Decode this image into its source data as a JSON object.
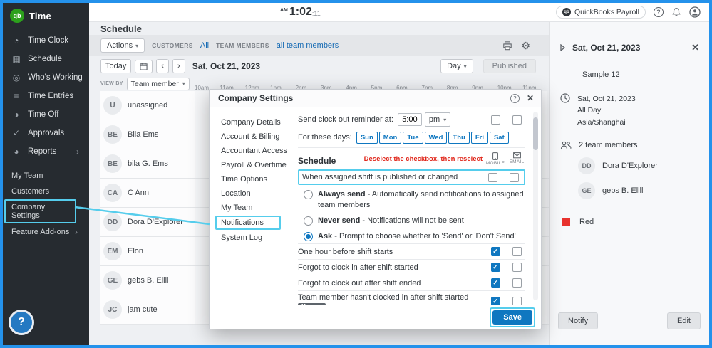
{
  "glyphs": {
    "caret": "▾",
    "chev_left": "‹",
    "chev_right": "›",
    "close": "✕",
    "gear": "⚙",
    "qmark": "?"
  },
  "topbar": {
    "clock_ampm": "AM",
    "clock_time": "1:02",
    "clock_sec": ":11",
    "product_badge": "QuickBooks Payroll",
    "badge_logo": "qb"
  },
  "sidebar": {
    "logo_text": "qb",
    "brand": "Time",
    "items": [
      {
        "label": "Time Clock",
        "glyph": "◔",
        "icon": "time-clock-icon"
      },
      {
        "label": "Schedule",
        "glyph": "▦",
        "icon": "schedule-icon"
      },
      {
        "label": "Who's Working",
        "glyph": "◎",
        "icon": "whos-working-icon"
      },
      {
        "label": "Time Entries",
        "glyph": "≡",
        "icon": "time-entries-icon"
      },
      {
        "label": "Time Off",
        "glyph": "◑",
        "icon": "time-off-icon"
      },
      {
        "label": "Approvals",
        "glyph": "✓",
        "icon": "approvals-icon"
      },
      {
        "label": "Reports",
        "glyph": "◕",
        "icon": "reports-icon",
        "chevron": "›"
      }
    ],
    "links": [
      {
        "label": "My Team"
      },
      {
        "label": "Customers"
      },
      {
        "label": "Company Settings",
        "highlighted": true
      },
      {
        "label": "Feature Add-ons",
        "chevron": "›"
      }
    ],
    "help": "?"
  },
  "schedule": {
    "title": "Schedule",
    "actions_label": "Actions",
    "customers_label": "CUSTOMERS",
    "customers_value": "All",
    "team_label": "TEAM MEMBERS",
    "team_value": "all team members",
    "today_label": "Today",
    "date": "Sat, Oct 21, 2023",
    "view_mode": "Day",
    "published_label": "Published",
    "viewby_label": "VIEW BY",
    "viewby_value": "Team member",
    "time_columns": [
      "10am",
      "11am",
      "12pm",
      "1pm",
      "2pm",
      "3pm",
      "4pm",
      "5pm",
      "6pm",
      "7pm",
      "8pm",
      "9pm",
      "10pm",
      "11pm"
    ],
    "members": [
      {
        "initials": "U",
        "name": "unassigned"
      },
      {
        "initials": "BE",
        "name": "Bila Ems"
      },
      {
        "initials": "BE",
        "name": "bila G. Ems"
      },
      {
        "initials": "CA",
        "name": "C Ann"
      },
      {
        "initials": "DD",
        "name": "Dora D'Explorer"
      },
      {
        "initials": "EM",
        "name": "Elon"
      },
      {
        "initials": "GE",
        "name": "gebs B. Ellll"
      },
      {
        "initials": "JC",
        "name": "jam cute"
      }
    ]
  },
  "modal": {
    "title": "Company Settings",
    "nav": [
      {
        "label": "Company Details"
      },
      {
        "label": "Account & Billing"
      },
      {
        "label": "Accountant Access"
      },
      {
        "label": "Payroll & Overtime"
      },
      {
        "label": "Time Options"
      },
      {
        "label": "Location"
      },
      {
        "label": "My Team"
      },
      {
        "label": "Notifications",
        "highlighted": true
      },
      {
        "label": "System Log"
      }
    ],
    "reminder_label": "Send clock out reminder at:",
    "reminder_time": "5:00",
    "reminder_ampm": "pm",
    "days_label": "For these days:",
    "days": [
      "Sun",
      "Mon",
      "Tue",
      "Wed",
      "Thu",
      "Fri",
      "Sat"
    ],
    "section_title": "Schedule",
    "red_note": "Deselect the checkbox, then reselect",
    "col_mobile": "MOBILE",
    "col_email": "EMAIL",
    "highlight_row_label": "When assigned shift is published or changed",
    "radios": [
      {
        "bold": "Always send",
        "rest": " - Automatically send notifications to assigned team members",
        "selected": false
      },
      {
        "bold": "Never send",
        "rest": " - Notifications will not be sent",
        "selected": false
      },
      {
        "bold": "Ask",
        "rest": " - Prompt to choose whether to 'Send' or 'Don't Send'",
        "selected": true
      }
    ],
    "rows": [
      {
        "label": "One hour before shift starts",
        "mobile": true,
        "email": false
      },
      {
        "label": "Forgot to clock in after shift started",
        "mobile": true,
        "email": false
      },
      {
        "label": "Forgot to clock out after shift ended",
        "mobile": true,
        "email": false
      },
      {
        "label": "Team member hasn't clocked in after shift started",
        "badge": "Manager",
        "mobile": true,
        "email": false
      }
    ],
    "save_label": "Save"
  },
  "panel": {
    "date": "Sat, Oct 21, 2023",
    "sample": "Sample 12",
    "when_date": "Sat, Oct 21, 2023",
    "when_allday": "All Day",
    "when_tz": "Asia/Shanghai",
    "team_count": "2 team members",
    "members": [
      {
        "initials": "DD",
        "name": "Dora D'Explorer"
      },
      {
        "initials": "GE",
        "name": "gebs B. Ellll"
      }
    ],
    "color_label": "Red",
    "color": "#e8322e",
    "notify_label": "Notify",
    "edit_label": "Edit"
  }
}
